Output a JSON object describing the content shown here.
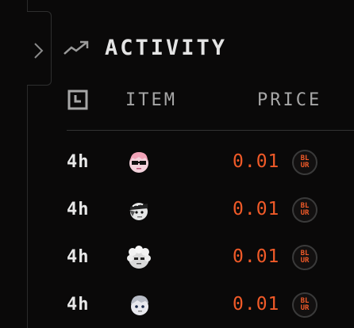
{
  "panel": {
    "title": "ACTIVITY",
    "columns": {
      "time_icon": "clock-icon",
      "item": "ITEM",
      "price": "PRICE"
    }
  },
  "rows": [
    {
      "time": "4h",
      "avatar": "pink-hair-sunglasses",
      "price": "0.01",
      "token": "BLUR"
    },
    {
      "time": "4h",
      "avatar": "bandana-character",
      "price": "0.01",
      "token": "BLUR"
    },
    {
      "time": "4h",
      "avatar": "white-fluffy-character",
      "price": "0.01",
      "token": "BLUR"
    },
    {
      "time": "4h",
      "avatar": "silver-hair-character",
      "price": "0.01",
      "token": "BLUR"
    }
  ],
  "colors": {
    "background": "#0a0909",
    "accent": "#f05a28",
    "text": "#e4e4e4",
    "muted": "#a7a7a7"
  }
}
